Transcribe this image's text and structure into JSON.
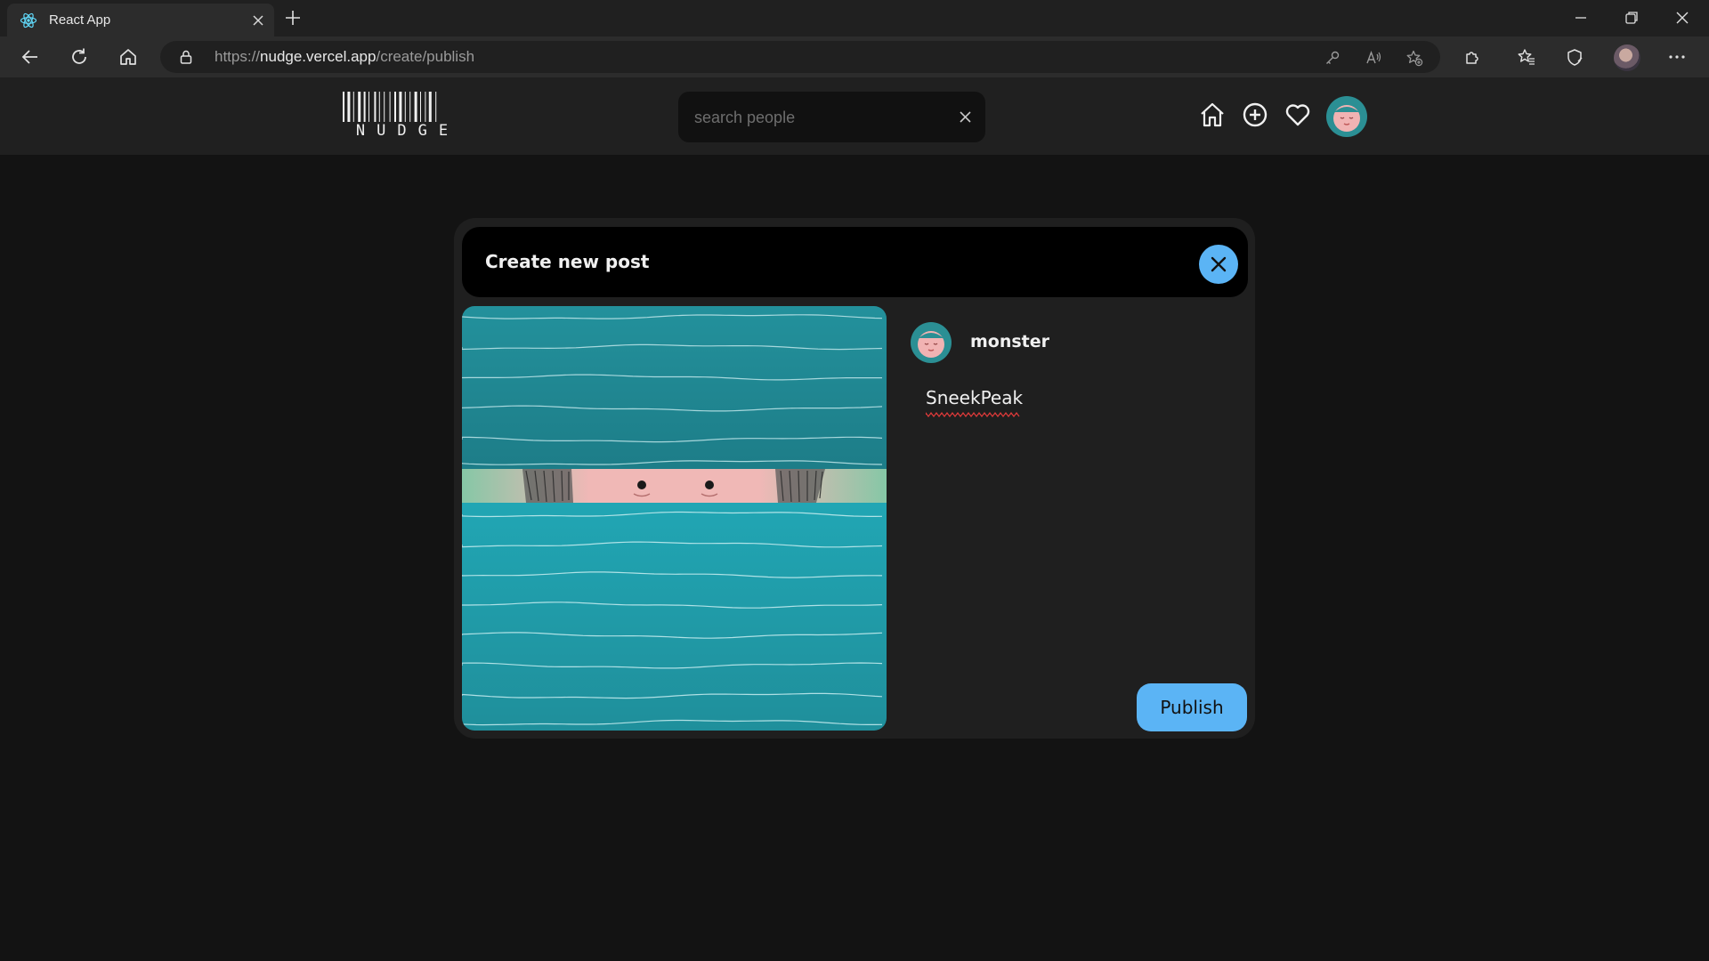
{
  "browser": {
    "tab_title": "React App",
    "url_prefix": "https://",
    "url_host": "nudge.vercel.app",
    "url_path": "/create/publish"
  },
  "header": {
    "logo_text": "NUDGE",
    "search_placeholder": "search people",
    "search_value": "",
    "icons": [
      "home-icon",
      "add-circle-icon",
      "heart-icon",
      "profile-avatar"
    ]
  },
  "modal": {
    "title": "Create new post",
    "username": "monster",
    "caption": "SneekPeak",
    "publish_label": "Publish"
  },
  "colors": {
    "accent": "#5bb4f5",
    "background": "#131313",
    "panel": "#1f1f1f",
    "header": "#202020",
    "teal": "#1f8a95"
  }
}
